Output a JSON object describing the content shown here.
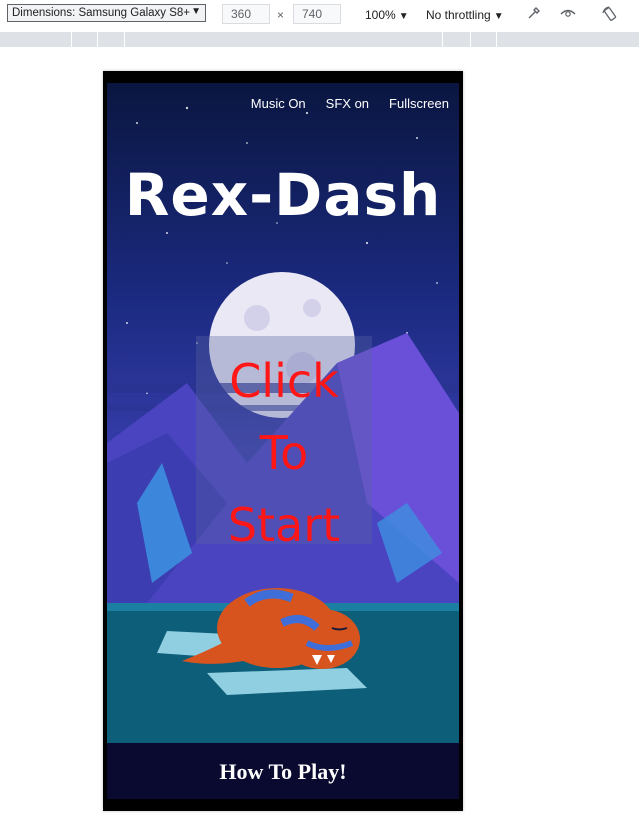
{
  "devtools": {
    "device_label": "Dimensions: Samsung Galaxy S8+",
    "width": "360",
    "height": "740",
    "times": "×",
    "zoom": "100%",
    "throttling": "No throttling",
    "icons": [
      "color-picker-icon",
      "eye-icon",
      "rotate-icon"
    ]
  },
  "game": {
    "menu": {
      "music": "Music On",
      "sfx": "SFX on",
      "fullscreen": "Fullscreen"
    },
    "title": "Rex-Dash",
    "start_lines": [
      "Click",
      "To",
      "Start"
    ],
    "how_to_play": "How To Play!",
    "colors": {
      "start_text": "#ff1616",
      "sky": "#1b2a80",
      "water": "#0d5e78"
    }
  }
}
